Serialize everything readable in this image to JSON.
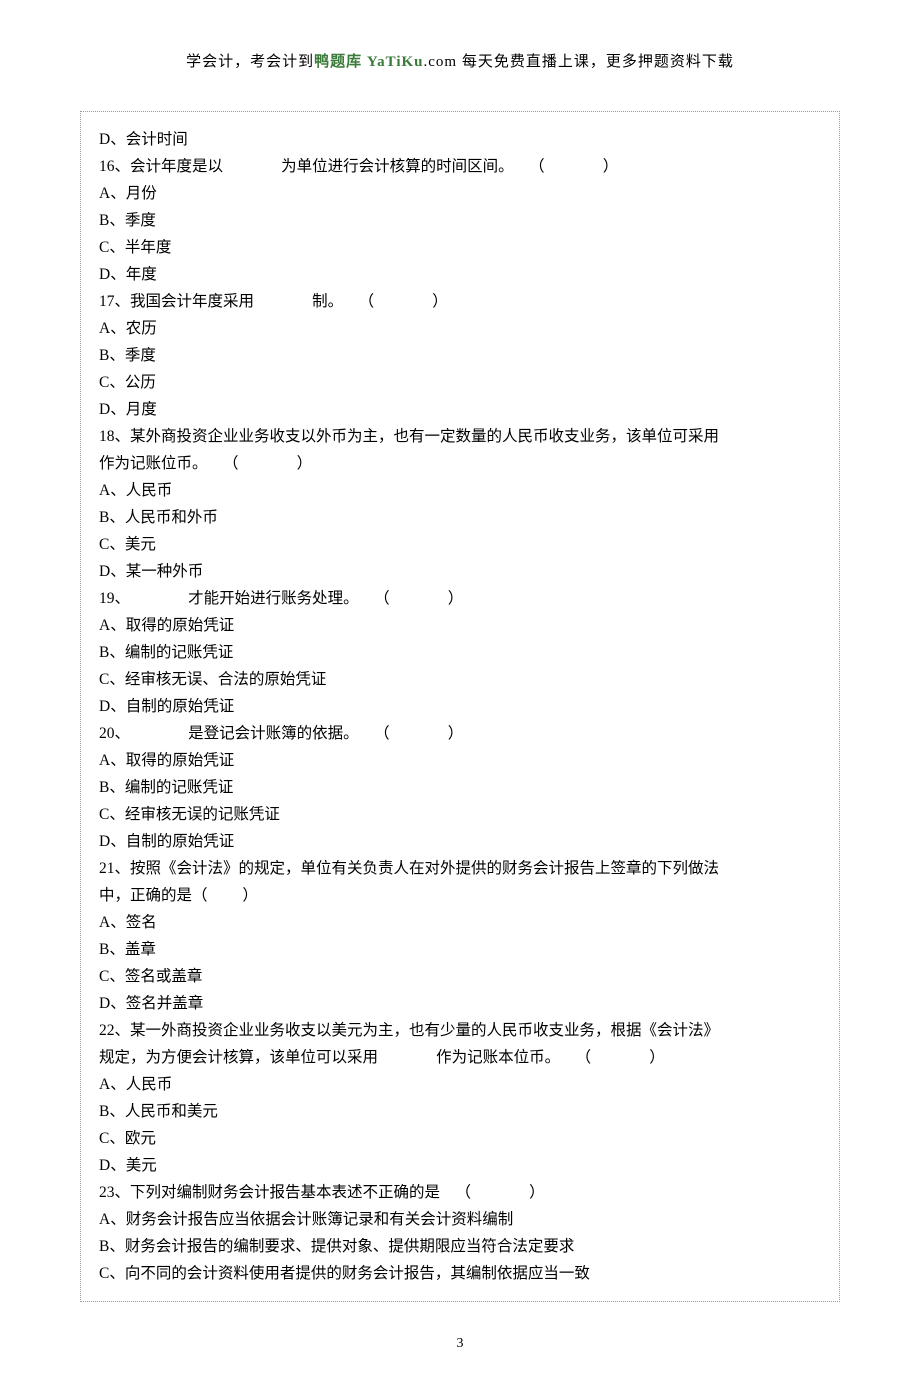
{
  "header": {
    "prefix": "学会计，考会计到",
    "brand1": "鸭题库",
    "brand2": " YaTiKu",
    "brand_suffix": ".com",
    "suffix": " 每天免费直播上课，更多押题资料下载"
  },
  "lines": {
    "q15_d": "D、会计时间",
    "q16": "16、会计年度是以               为单位进行会计核算的时间区间。    （               ）",
    "q16_a": "A、月份",
    "q16_b": "B、季度",
    "q16_c": "C、半年度",
    "q16_d": "D、年度",
    "q17": "17、我国会计年度采用               制。    （               ）",
    "q17_a": "A、农历",
    "q17_b": "B、季度",
    "q17_c": "C、公历",
    "q17_d": "D、月度",
    "q18_l1": "18、某外商投资企业业务收支以外币为主，也有一定数量的人民币收支业务，该单位可采用",
    "q18_l2": "作为记账位币。    （               ）",
    "q18_a": "A、人民币",
    "q18_b": "B、人民币和外币",
    "q18_c": "C、美元",
    "q18_d": "D、某一种外币",
    "q19": "19、               才能开始进行账务处理。    （               ）",
    "q19_a": "A、取得的原始凭证",
    "q19_b": "B、编制的记账凭证",
    "q19_c": "C、经审核无误、合法的原始凭证",
    "q19_d": "D、自制的原始凭证",
    "q20": "20、               是登记会计账簿的依据。    （               ）",
    "q20_a": "A、取得的原始凭证",
    "q20_b": "B、编制的记账凭证",
    "q20_c": "C、经审核无误的记账凭证",
    "q20_d": "D、自制的原始凭证",
    "q21_l1": "21、按照《会计法》的规定，单位有关负责人在对外提供的财务会计报告上签章的下列做法",
    "q21_l2": "中，正确的是（         ）",
    "q21_a": "A、签名",
    "q21_b": "B、盖章",
    "q21_c": "C、签名或盖章",
    "q21_d": "D、签名并盖章",
    "q22_l1": "22、某一外商投资企业业务收支以美元为主，也有少量的人民币收支业务，根据《会计法》",
    "q22_l2": "规定，为方便会计核算，该单位可以采用               作为记账本位币。    （               ）",
    "q22_a": "A、人民币",
    "q22_b": "B、人民币和美元",
    "q22_c": "C、欧元",
    "q22_d": "D、美元",
    "q23": "23、下列对编制财务会计报告基本表述不正确的是    （               ）",
    "q23_a": "A、财务会计报告应当依据会计账簿记录和有关会计资料编制",
    "q23_b": "B、财务会计报告的编制要求、提供对象、提供期限应当符合法定要求",
    "q23_c": "C、向不同的会计资料使用者提供的财务会计报告，其编制依据应当一致"
  },
  "footer": {
    "page_number": "3"
  }
}
